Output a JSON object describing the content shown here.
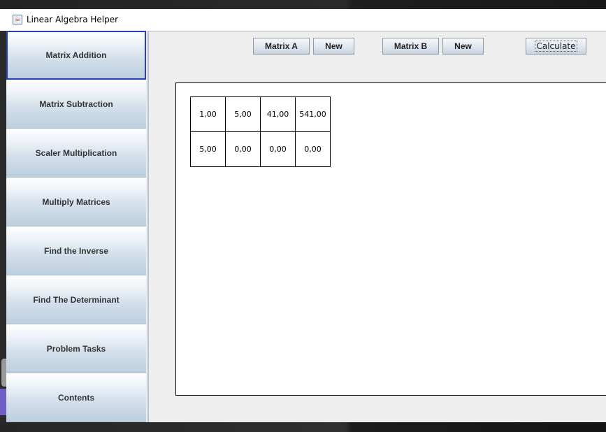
{
  "window": {
    "title": "Linear Algebra Helper"
  },
  "sidebar": {
    "items": [
      {
        "label": "Matrix Addition"
      },
      {
        "label": "Matrix Subtraction"
      },
      {
        "label": "Scaler Multiplication"
      },
      {
        "label": "Multiply Matrices"
      },
      {
        "label": "Find the Inverse"
      },
      {
        "label": "Find The Determinant"
      },
      {
        "label": "Problem Tasks"
      },
      {
        "label": "Contents"
      }
    ],
    "selected_index": 0
  },
  "toolbar": {
    "matrix_a_label": "Matrix A",
    "new_a_label": "New",
    "matrix_b_label": "Matrix B",
    "new_b_label": "New",
    "calculate_label": "Calculate"
  },
  "matrix": {
    "rows": [
      [
        "1,00",
        "5,00",
        "41,00",
        "541,00"
      ],
      [
        "5,00",
        "0,00",
        "0,00",
        "0,00"
      ]
    ]
  },
  "colors": {
    "selection_border": "#2a3fb0",
    "sidebar_gradient_top": "#ffffff",
    "sidebar_gradient_bottom": "#bccfdf",
    "window_bg": "#eeeeee"
  }
}
